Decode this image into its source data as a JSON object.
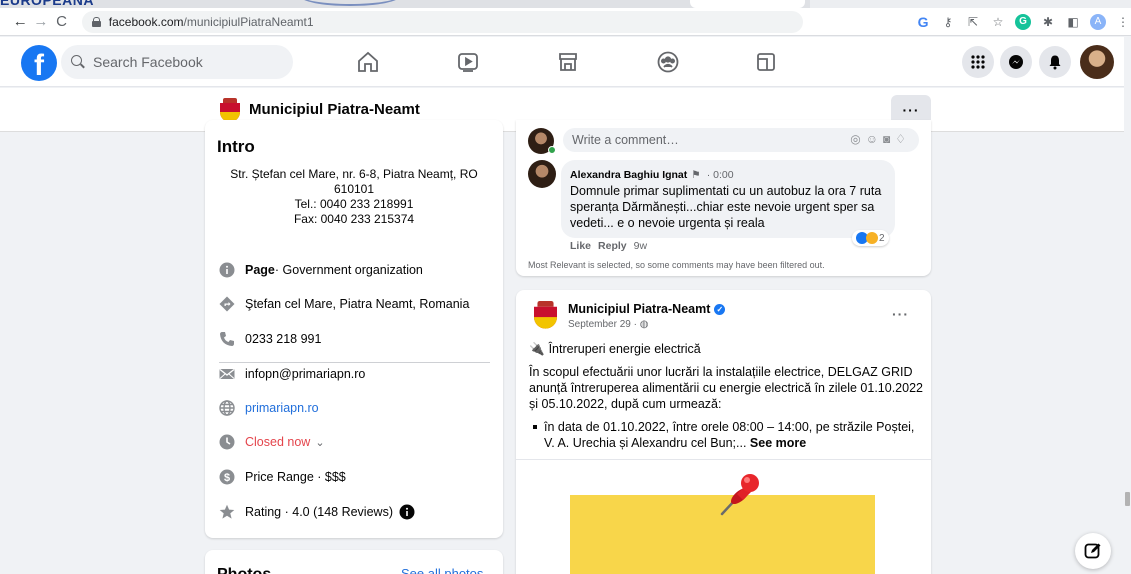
{
  "browser": {
    "banner": "EUROPEANA",
    "url_domain": "facebook.com",
    "url_path": "/municipiulPiatraNeamt1",
    "profile_initial": "A"
  },
  "fb": {
    "search_placeholder": "Search Facebook"
  },
  "page": {
    "name": "Municipiul Piatra-Neamt",
    "more_label": "···"
  },
  "intro": {
    "title": "Intro",
    "address_line1": "Str. Ștefan cel Mare, nr. 6-8, Piatra Neamț, RO",
    "address_line2": "610101",
    "tel": "Tel.: 0040 233 218991",
    "fax": "Fax: 0040 233 215374",
    "category_bold": "Page",
    "category_rest": " · Government organization",
    "location": "Ştefan cel Mare, Piatra Neamt, Romania",
    "phone": "0233 218 991",
    "email": "infopn@primariapn.ro",
    "website": "primariapn.ro",
    "hours": "Closed now",
    "hours_chevron": "⌄",
    "price": "Price Range · $$$",
    "rating": "Rating · 4.0 (148 Reviews)"
  },
  "photos": {
    "title": "Photos",
    "see_all": "See all photos"
  },
  "comments": {
    "write_placeholder": "Write a comment…",
    "author": "Alexandra Baghiu Ignat",
    "author_flag": "⚑",
    "time": "· 0:00",
    "text": "Domnule primar suplimentati cu un autobuz la ora 7 ruta speranța Dărmănești...chiar este nevoie urgent sper sa vedeti... e o nevoie urgenta și reala",
    "reaction_count": "2",
    "like": "Like",
    "reply": "Reply",
    "age": "9w",
    "note": "Most Relevant is selected, so some comments may have been filtered out."
  },
  "post": {
    "author": "Municipiul Piatra-Neamt",
    "date": "September 29 · ",
    "title": "Întreruperi energie electrică",
    "body": "În scopul efectuării unor lucrări la instalațiile electrice, DELGAZ GRID anunță întreruperea alimentării cu energie electrică în zilele 01.10.2022 și 05.10.2022, după cum urmează:",
    "bullet": "în data de 01.10.2022, între orele 08:00 – 14:00, pe străzile Poștei, V. A. Urechia și Alexandru cel Bun;...",
    "see_more": "See more",
    "more": "···"
  },
  "colors": {
    "fb_blue": "#1877f2",
    "link": "#216fdb",
    "closed_red": "#e4454c",
    "background": "#f0f2f5"
  }
}
